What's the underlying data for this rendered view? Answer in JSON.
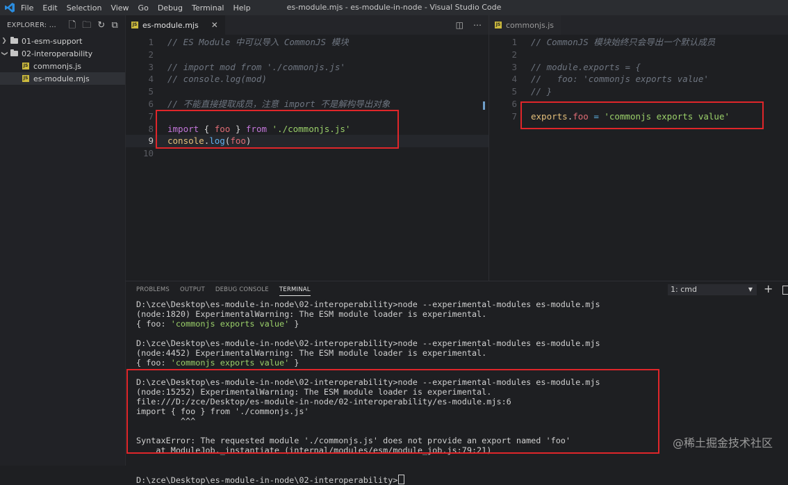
{
  "window": {
    "title": "es-module.mjs - es-module-in-node - Visual Studio Code"
  },
  "menu": [
    "File",
    "Edit",
    "Selection",
    "View",
    "Go",
    "Debug",
    "Terminal",
    "Help"
  ],
  "sidebar": {
    "header": "EXPLORER: ...",
    "tree": [
      {
        "label": "01-esm-support",
        "type": "folder",
        "expanded": false
      },
      {
        "label": "02-interoperability",
        "type": "folder",
        "expanded": true
      },
      {
        "label": "commonjs.js",
        "type": "file"
      },
      {
        "label": "es-module.mjs",
        "type": "file",
        "active": true
      }
    ]
  },
  "editors": {
    "left": {
      "tab": "es-module.mjs",
      "line_numbers": [
        "1",
        "2",
        "3",
        "4",
        "5",
        "6",
        "7",
        "8",
        "9",
        "10"
      ],
      "lines": {
        "l1": "// ES Module 中可以导入 CommonJS 模块",
        "l3": "// import mod from './commonjs.js'",
        "l4": "// console.log(mod)",
        "l6": "// 不能直接提取成员，注意 import 不是解构导出对象",
        "l8_import": "import",
        "l8_open": " { ",
        "l8_foo": "foo",
        "l8_close": " } ",
        "l8_from": "from",
        "l8_path": " './commonjs.js'",
        "l9_console": "console",
        "l9_dot": ".",
        "l9_log": "log",
        "l9_open": "(",
        "l9_foo": "foo",
        "l9_close": ")"
      }
    },
    "right": {
      "tab": "commonjs.js",
      "line_numbers": [
        "1",
        "2",
        "3",
        "4",
        "5",
        "6",
        "7"
      ],
      "lines": {
        "l1": "// CommonJS 模块始终只会导出一个默认成员",
        "l3": "// module.exports = {",
        "l4": "//   foo: 'commonjs exports value'",
        "l5": "// }",
        "l7_exports": "exports",
        "l7_dot": ".",
        "l7_foo": "foo",
        "l7_eq": " = ",
        "l7_str": "'commonjs exports value'"
      }
    }
  },
  "panel": {
    "tabs": [
      "PROBLEMS",
      "OUTPUT",
      "DEBUG CONSOLE",
      "TERMINAL"
    ],
    "active_tab": "TERMINAL",
    "terminal_select": "1: cmd",
    "terminal": {
      "b1_cmd": "D:\\zce\\Desktop\\es-module-in-node\\02-interoperability>node --experimental-modules es-module.mjs",
      "b1_warn": "(node:1820) ExperimentalWarning: The ESM module loader is experimental.",
      "b1_out_a": "{ foo: ",
      "b1_out_str": "'commonjs exports value'",
      "b1_out_b": " }",
      "b2_cmd": "D:\\zce\\Desktop\\es-module-in-node\\02-interoperability>node --experimental-modules es-module.mjs",
      "b2_warn": "(node:4452) ExperimentalWarning: The ESM module loader is experimental.",
      "b2_out_a": "{ foo: ",
      "b2_out_str": "'commonjs exports value'",
      "b2_out_b": " }",
      "b3_cmd": "D:\\zce\\Desktop\\es-module-in-node\\02-interoperability>node --experimental-modules es-module.mjs",
      "b3_warn": "(node:15252) ExperimentalWarning: The ESM module loader is experimental.",
      "b3_file": "file:///D:/zce/Desktop/es-module-in-node/02-interoperability/es-module.mjs:6",
      "b3_src": "import { foo } from './commonjs.js'",
      "b3_caret": "         ^^^",
      "b3_err": "SyntaxError: The requested module './commonjs.js' does not provide an export named 'foo'",
      "b3_at": "    at ModuleJob._instantiate (internal/modules/esm/module_job.js:79:21)",
      "prompt": "D:\\zce\\Desktop\\es-module-in-node\\02-interoperability>"
    }
  },
  "watermark": "@稀土掘金技术社区",
  "colors": {
    "highlight_box": "#e0262a",
    "background": "#1e1f22"
  }
}
